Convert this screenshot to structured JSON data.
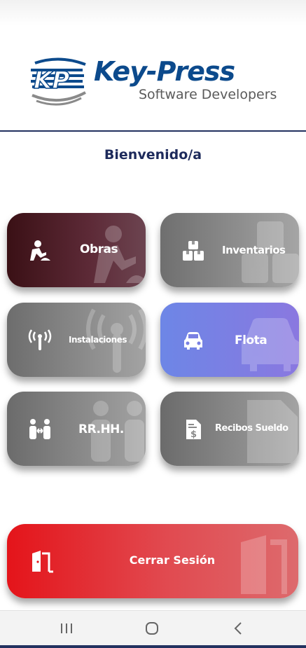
{
  "brand": {
    "name": "Key-Press",
    "tagline": "Software Developers",
    "mark_text": "KP"
  },
  "welcome": "Bienvenido/a",
  "tiles": [
    {
      "label": "Obras",
      "icon": "construction-worker-icon"
    },
    {
      "label": "Inventarios",
      "icon": "boxes-icon"
    },
    {
      "label": "Instalaciones",
      "icon": "antenna-signal-icon"
    },
    {
      "label": "Flota",
      "icon": "car-icon"
    },
    {
      "label": "RR.HH.",
      "icon": "people-exchange-icon"
    },
    {
      "label": "Recibos Sueldo",
      "icon": "receipt-dollar-icon"
    }
  ],
  "logout": {
    "label": "Cerrar Sesión",
    "icon": "door-exit-icon"
  },
  "nav": {
    "recents": "recents-icon",
    "home": "home-icon",
    "back": "back-icon"
  },
  "colors": {
    "brand_blue": "#0c4a8c",
    "header_rule": "#22315f",
    "logout_red": "#e4141a",
    "flota_blue": "#6d86e6"
  }
}
